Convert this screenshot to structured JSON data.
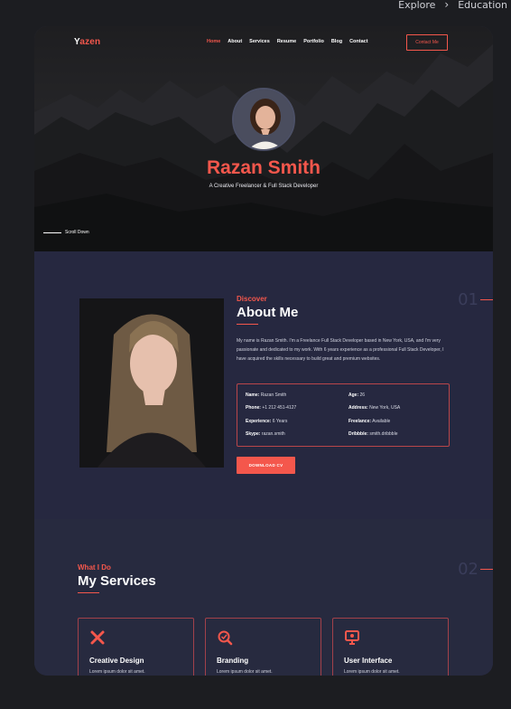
{
  "breadcrumb": {
    "items": [
      "Explore",
      "Education"
    ],
    "separator": "›"
  },
  "nav": {
    "logo_first": "Y",
    "logo_rest": "azen",
    "items": [
      "Home",
      "About",
      "Services",
      "Resume",
      "Portfolio",
      "Blog",
      "Contact"
    ],
    "active": "Home",
    "contact_button": "Contact Me"
  },
  "hero": {
    "name": "Razan Smith",
    "subtitle": "A Creative Freelancer & Full Stack Developer",
    "scroll_label": "Scroll Down"
  },
  "about": {
    "number": "01",
    "kicker": "Discover",
    "title": "About Me",
    "bio": "My name is Razan Smith. I'm a Freelance Full Stack Developer based in New York, USA, and I'm very passionate and dedicated to my work. With 6 years experience as a professional Full Stack Developer, I have acquired the skills necessary to build great and premium websites.",
    "info": [
      {
        "label": "Name:",
        "value": "Razan Smith"
      },
      {
        "label": "Age:",
        "value": "26"
      },
      {
        "label": "Phone:",
        "value": "+1 212 451-4127"
      },
      {
        "label": "Address:",
        "value": "New York, USA"
      },
      {
        "label": "Experience:",
        "value": "6 Years"
      },
      {
        "label": "Freelance:",
        "value": "Available"
      },
      {
        "label": "Skype:",
        "value": "razan.smith"
      },
      {
        "label": "Dribbble:",
        "value": "smith.dribbble"
      }
    ],
    "download_button": "DOWNLOAD CV"
  },
  "services": {
    "number": "02",
    "kicker": "What I Do",
    "title": "My Services",
    "cards": [
      {
        "title": "Creative Design",
        "desc": "Lorem ipsum dolor sit amet.",
        "icon": "design-icon"
      },
      {
        "title": "Branding",
        "desc": "Lorem ipsum dolor sit amet.",
        "icon": "branding-icon"
      },
      {
        "title": "User Interface",
        "desc": "Lorem ipsum dolor sit amet.",
        "icon": "ui-icon"
      }
    ]
  },
  "colors": {
    "accent": "#f4574c",
    "bg": "#262840",
    "page": "#1c1d21"
  }
}
